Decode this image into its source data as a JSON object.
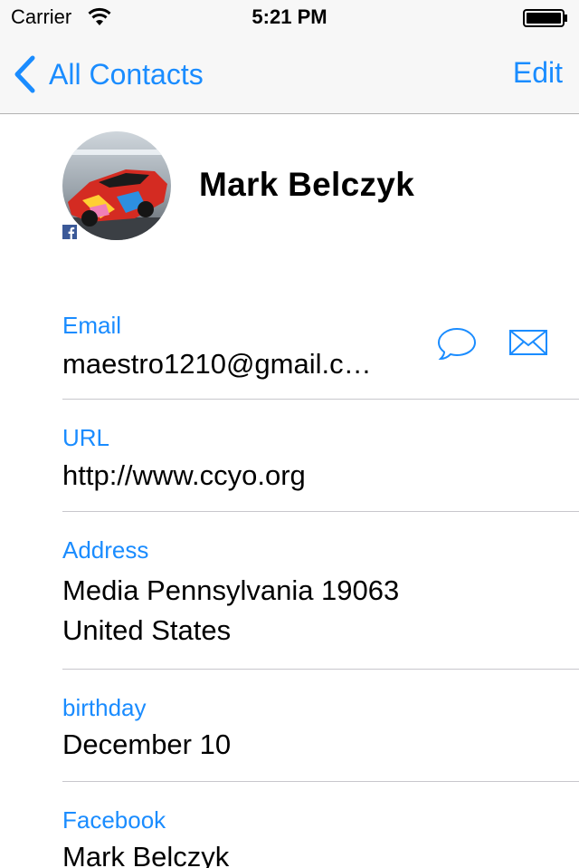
{
  "status": {
    "carrier": "Carrier",
    "time": "5:21 PM"
  },
  "nav": {
    "back_label": "All Contacts",
    "edit_label": "Edit"
  },
  "contact": {
    "name": "Mark Belczyk"
  },
  "fields": {
    "email": {
      "label": "Email",
      "value": "maestro1210@gmail.c…"
    },
    "url": {
      "label": "URL",
      "value": "http://www.ccyo.org"
    },
    "address": {
      "label": "Address",
      "line1": "Media Pennsylvania 19063",
      "line2": "United States"
    },
    "birthday": {
      "label": "birthday",
      "value": "December 10"
    },
    "facebook": {
      "label": "Facebook",
      "value": "Mark Belczyk"
    }
  },
  "icons": {
    "back": "chevron-left-icon",
    "message": "message-bubble-icon",
    "mail": "mail-envelope-icon",
    "wifi": "wifi-icon",
    "battery": "battery-icon",
    "facebook": "facebook-badge-icon"
  },
  "colors": {
    "accent": "#1a8cff",
    "separator": "#c8c7cc",
    "bar_background": "#f7f7f7"
  }
}
